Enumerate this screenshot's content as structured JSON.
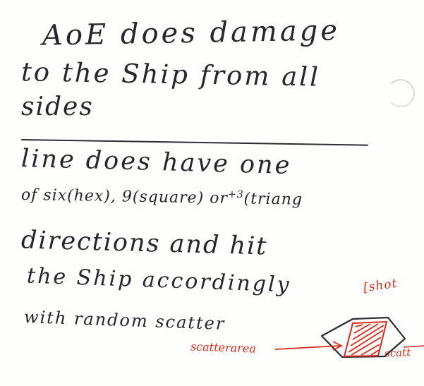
{
  "note": {
    "top": {
      "line1": "AoE does damage",
      "line2": "to the Ship from all",
      "line3": "sides"
    },
    "bottom": {
      "line1": "line does have one",
      "line2_pre": "of  six(hex), 9(square) or",
      "line2_sup": "+3",
      "line2_post": "(triang",
      "line3": "directions and hit",
      "line4": "the Ship accordingly",
      "line4_note": "[shot",
      "line5": "with random scatter"
    },
    "annotations": {
      "scatter_area": "scatterarea",
      "scatt": "scatt"
    }
  },
  "colors": {
    "ink": "#26262c",
    "red_ink": "#e0281c",
    "paper": "#fefefc"
  }
}
